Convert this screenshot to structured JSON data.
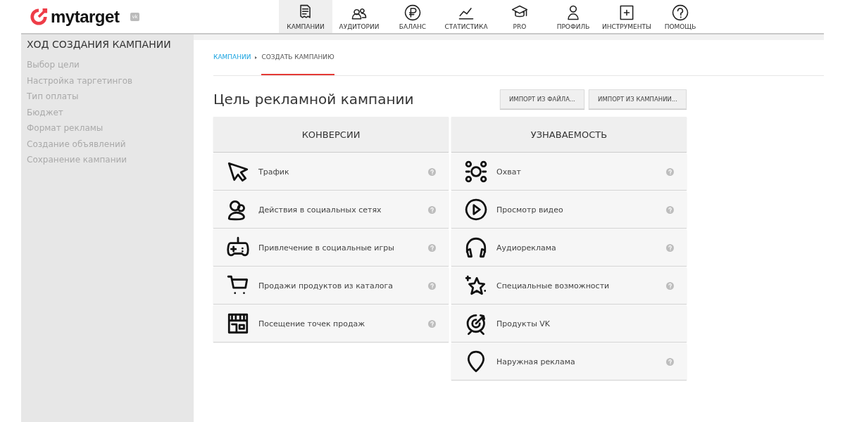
{
  "header": {
    "logo": "mytarget",
    "badge": "vk"
  },
  "nav": [
    {
      "label": "КАМПАНИИ",
      "kind": "doc",
      "selected": true
    },
    {
      "label": "АУДИТОРИИ",
      "kind": "people",
      "selected": false
    },
    {
      "label": "БАЛАНС",
      "kind": "ruble",
      "selected": false
    },
    {
      "label": "СТАТИСТИКА",
      "kind": "chart",
      "selected": false
    },
    {
      "label": "PRO",
      "kind": "cap",
      "selected": false
    },
    {
      "label": "ПРОФИЛЬ",
      "kind": "person",
      "selected": false
    },
    {
      "label": "ИНСТРУМЕНТЫ",
      "kind": "tool",
      "selected": false
    },
    {
      "label": "ПОМОЩЬ",
      "kind": "help",
      "selected": false
    }
  ],
  "sidebar": {
    "title": "ХОД СОЗДАНИЯ КАМПАНИИ",
    "items": [
      "Выбор цели",
      "Настройка таргетингов",
      "Тип оплаты",
      "Бюджет",
      "Формат рекламы",
      "Создание объявлений",
      "Сохранение кампании"
    ]
  },
  "breadcrumbs": [
    {
      "label": "КАМПАНИИ",
      "kind": "link"
    },
    {
      "label": "СОЗДАТЬ КАМПАНИЮ",
      "kind": "current"
    }
  ],
  "title": "Цель рекламной кампании",
  "buttons": [
    "ИМПОРТ ИЗ ФАЙЛА...",
    "ИМПОРТ ИЗ КАМПАНИИ..."
  ],
  "columns": [
    {
      "heading": "КОНВЕРСИИ",
      "items": [
        {
          "label": "Трафик",
          "kind": "cursor",
          "help": true
        },
        {
          "label": "Действия в социальных сетях",
          "kind": "social",
          "help": true
        },
        {
          "label": "Привлечение в социальные игры",
          "kind": "gamepad",
          "help": true
        },
        {
          "label": "Продажи продуктов из каталога",
          "kind": "cart",
          "help": true
        },
        {
          "label": "Посещение точек продаж",
          "kind": "store",
          "help": true
        }
      ]
    },
    {
      "heading": "УЗНАВАЕМОСТЬ",
      "items": [
        {
          "label": "Охват",
          "kind": "reach",
          "help": true
        },
        {
          "label": "Просмотр видео",
          "kind": "play",
          "help": true
        },
        {
          "label": "Аудиореклама",
          "kind": "headphones",
          "help": true
        },
        {
          "label": "Специальные возможности",
          "kind": "star",
          "help": true
        },
        {
          "label": "Продукты VK",
          "kind": "target",
          "help": false
        },
        {
          "label": "Наружная реклама",
          "kind": "pin",
          "help": true
        }
      ]
    }
  ]
}
